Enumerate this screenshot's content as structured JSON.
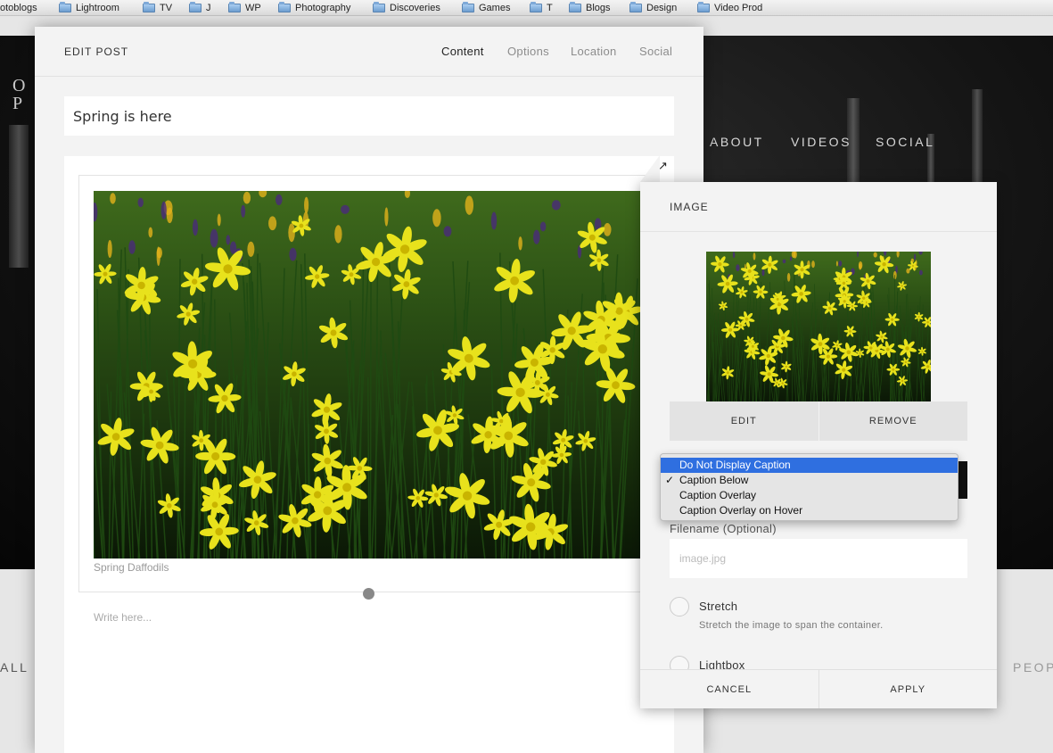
{
  "bookmarks": [
    {
      "label": "otoblogs",
      "folder": false
    },
    {
      "label": "Lightroom",
      "folder": true
    },
    {
      "label": "TV",
      "folder": true
    },
    {
      "label": "J",
      "folder": true
    },
    {
      "label": "WP",
      "folder": true
    },
    {
      "label": "Photography",
      "folder": true
    },
    {
      "label": "Discoveries",
      "folder": true
    },
    {
      "label": "Games",
      "folder": true
    },
    {
      "label": "T",
      "folder": true
    },
    {
      "label": "Blogs",
      "folder": true
    },
    {
      "label": "Design",
      "folder": true
    },
    {
      "label": "Video Prod",
      "folder": true
    }
  ],
  "site": {
    "nav": [
      "ABOUT",
      "VIDEOS",
      "SOCIAL"
    ],
    "bottom_left": "ALL",
    "bottom_right": "PEOP"
  },
  "editor": {
    "title": "EDIT POST",
    "tabs": [
      "Content",
      "Options",
      "Location",
      "Social"
    ],
    "active_tab": "Content",
    "post_title": "Spring is here",
    "image_caption": "Spring Daffodils",
    "body_placeholder": "Write here..."
  },
  "image_panel": {
    "title": "IMAGE",
    "edit_label": "EDIT",
    "remove_label": "REMOVE",
    "caption_options": [
      "Do Not Display Caption",
      "Caption Below",
      "Caption Overlay",
      "Caption Overlay on Hover"
    ],
    "caption_highlighted": "Do Not Display Caption",
    "caption_selected": "Caption Below",
    "check_mark": "✓",
    "filename_label": "Filename (Optional)",
    "filename_placeholder": "image.jpg",
    "options": [
      {
        "label": "Stretch",
        "description": "Stretch the image to span the container."
      },
      {
        "label": "Lightbox",
        "description": ""
      }
    ],
    "cancel_label": "CANCEL",
    "apply_label": "APPLY"
  },
  "colors": {
    "menu_highlight": "#2f6fe0",
    "flower_yellow": "#e8e21c",
    "foliage": "#1c3a10"
  }
}
